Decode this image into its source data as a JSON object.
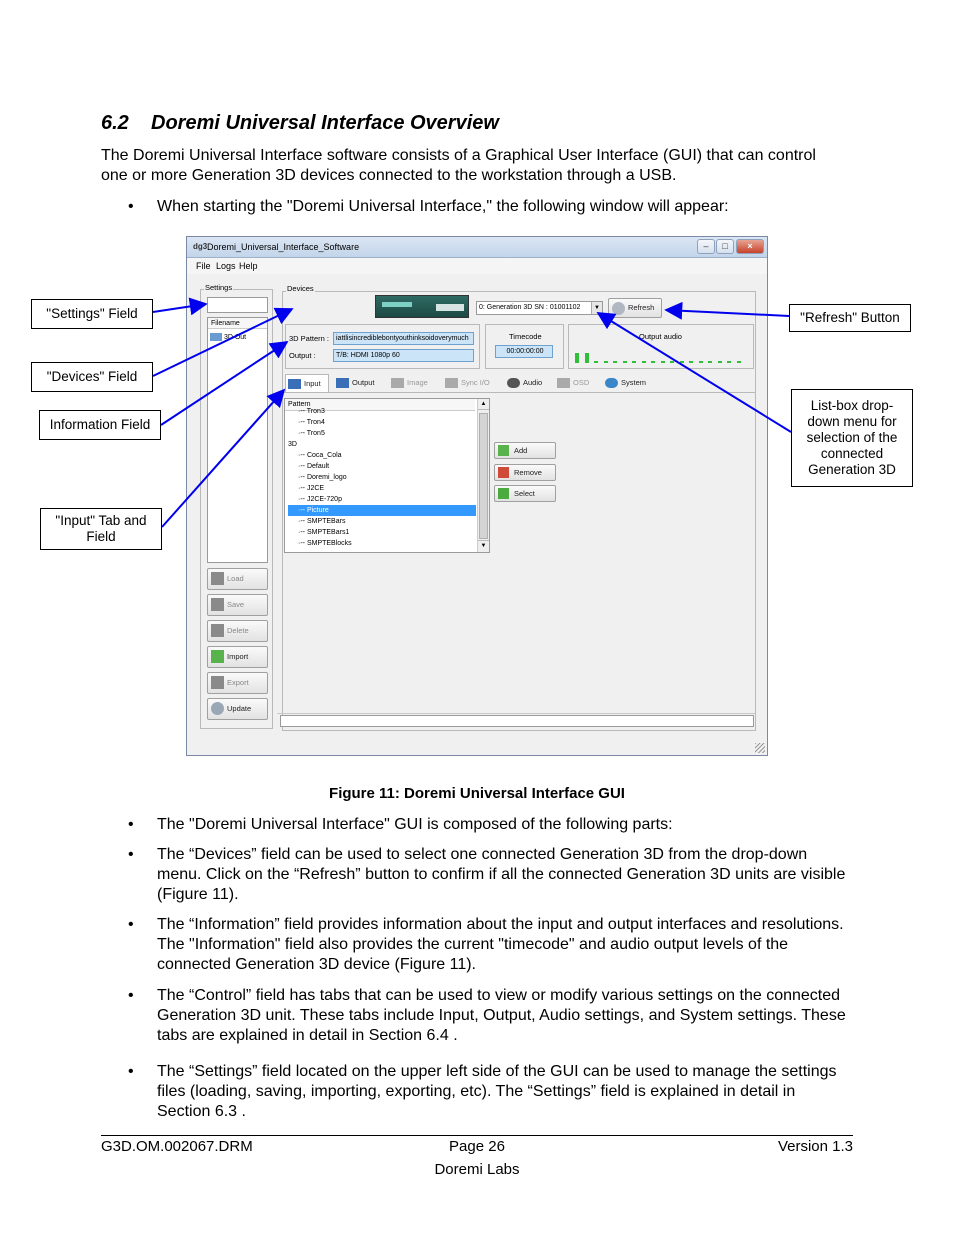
{
  "heading": {
    "number": "6.2",
    "title": "Doremi Universal Interface Overview"
  },
  "intro": "The Doremi Universal Interface software consists of a Graphical User Interface (GUI) that can control one or more Generation 3D devices connected to the workstation through a USB.",
  "bullet_start": "When starting the \"Doremi Universal Interface,\" the following window will appear:",
  "bullet_glyph": "•",
  "screenshot": {
    "window_title": "Doremi_Universal_Interface_Software",
    "logo_text": "dg3",
    "menu": [
      "File",
      "Logs",
      "Help"
    ],
    "settings_label": "Settings",
    "filename_header": "Filename",
    "file_item": "3D Out",
    "devices_label": "Devices",
    "device_select": "0: Generation 3D SN : 01001102",
    "refresh_label": "Refresh",
    "pattern_label": "3D Pattern :",
    "pattern_value": "iattlisincrediblebontyouthinksoidoverymuch",
    "output_label": "Output :",
    "output_value": "T/B: HDMI 1080p 60",
    "timecode_label": "Timecode",
    "timecode_value": "00:00:00:00",
    "audio_label": "Output audio",
    "tabs": [
      {
        "label": "Input",
        "enabled": true
      },
      {
        "label": "Output",
        "enabled": true
      },
      {
        "label": "Image",
        "enabled": false
      },
      {
        "label": "Sync I/O",
        "enabled": false
      },
      {
        "label": "Audio",
        "enabled": true
      },
      {
        "label": "OSD",
        "enabled": false
      },
      {
        "label": "System",
        "enabled": true
      }
    ],
    "pattern_list_header": "Pattern",
    "pattern_tree": [
      "Tron3",
      "Tron4",
      "Tron5",
      "3D",
      "Coca_Cola",
      "Default",
      "Doremi_logo",
      "J2CE",
      "J2CE-720p",
      "Picture",
      "SMPTEBars",
      "SMPTEBars1",
      "SMPTEBlocks"
    ],
    "selected_pattern": "Picture",
    "action_buttons": [
      "Add",
      "Remove",
      "Select"
    ],
    "settings_buttons": [
      {
        "label": "Load",
        "enabled": false
      },
      {
        "label": "Save",
        "enabled": false
      },
      {
        "label": "Delete",
        "enabled": false
      },
      {
        "label": "Import",
        "enabled": true
      },
      {
        "label": "Export",
        "enabled": false
      },
      {
        "label": "Update",
        "enabled": true
      }
    ]
  },
  "callouts": {
    "settings": "\"Settings\" Field",
    "devices": "\"Devices\" Field",
    "information": "Information Field",
    "input_tab": "\"Input\" Tab and Field",
    "refresh": "\"Refresh\" Button",
    "listbox": "List-box drop-down menu for selection of the connected Generation 3D"
  },
  "caption": "Figure 11: Doremi Universal Interface GUI",
  "bullets": [
    "The \"Doremi Universal Interface\" GUI is composed of the following parts:",
    "The “Devices” field can be used to select one connected Generation 3D from the drop-down menu. Click on the “Refresh” button to confirm if all the connected Generation 3D units are visible (Figure 11).",
    "The “Information” field provides information about the input and output interfaces and resolutions. The \"Information\" field also provides the current \"timecode\" and audio output levels of the connected Generation 3D device (Figure 11).",
    "The “Control” field has tabs that can be used to view or modify various settings on the connected Generation 3D unit. These tabs include Input, Output, Audio settings, and System settings. These  tabs are explained in detail in Section 6.4 .",
    "The “Settings” field located on the upper left side of the GUI can be used to manage the settings files (loading, saving, importing, exporting, etc). The “Settings” field is explained in detail in Section 6.3 ."
  ],
  "footer": {
    "doc_id": "G3D.OM.002067.DRM",
    "page": "Page 26",
    "version": "Version 1.3",
    "company": "Doremi Labs"
  }
}
